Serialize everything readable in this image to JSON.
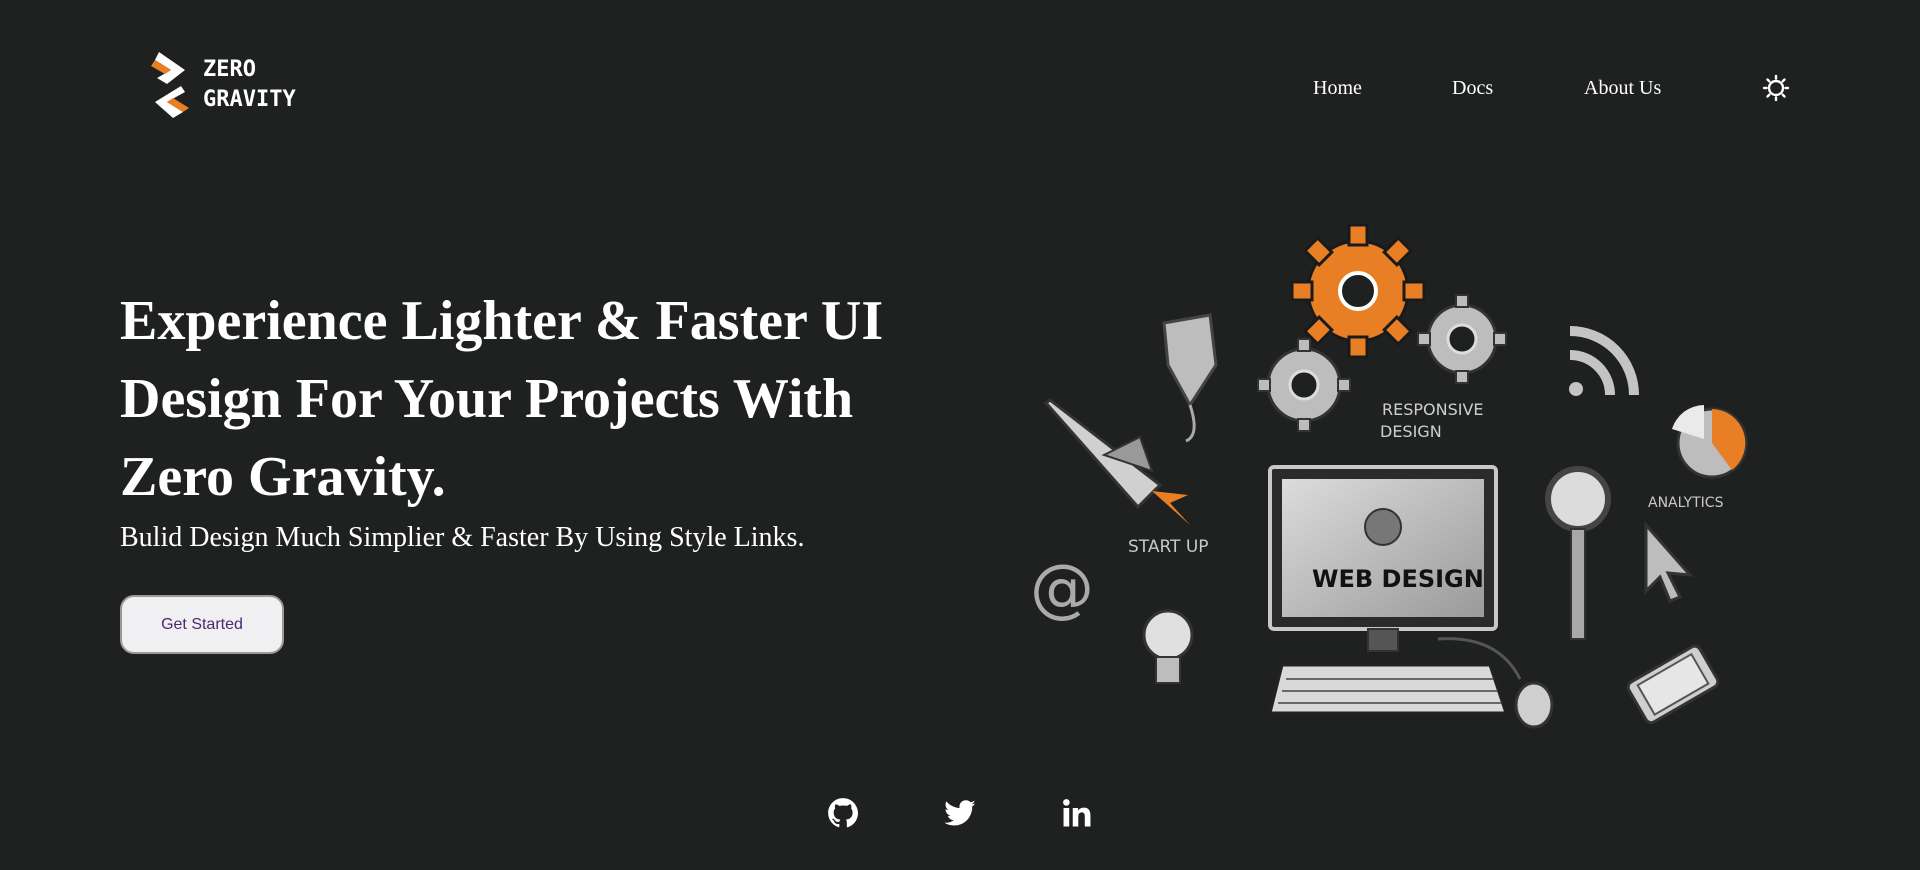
{
  "brand": {
    "line1": "ZERO",
    "line2": "GRAVITY",
    "accent": "#e87f24"
  },
  "nav": {
    "home": "Home",
    "docs": "Docs",
    "about": "About Us",
    "theme_icon": "sun-icon"
  },
  "hero": {
    "title": "Experience Lighter & Faster UI Design For Your Projects With Zero Gravity.",
    "subtitle": "Bulid Design Much Simplier & Faster By Using Style Links.",
    "cta_label": "Get Started"
  },
  "illustration": {
    "responsive_label_1": "RESPONSIVE",
    "responsive_label_2": "DESIGN",
    "startup_label": "START UP",
    "analytics_label": "ANALYTICS",
    "screen_label": "WEB DESIGN"
  },
  "social": [
    "github-icon",
    "twitter-icon",
    "linkedin-icon"
  ],
  "colors": {
    "background": "#1f2020",
    "text": "#ffffff",
    "button_bg": "#f0eff2",
    "button_text": "#4b2a6f"
  }
}
